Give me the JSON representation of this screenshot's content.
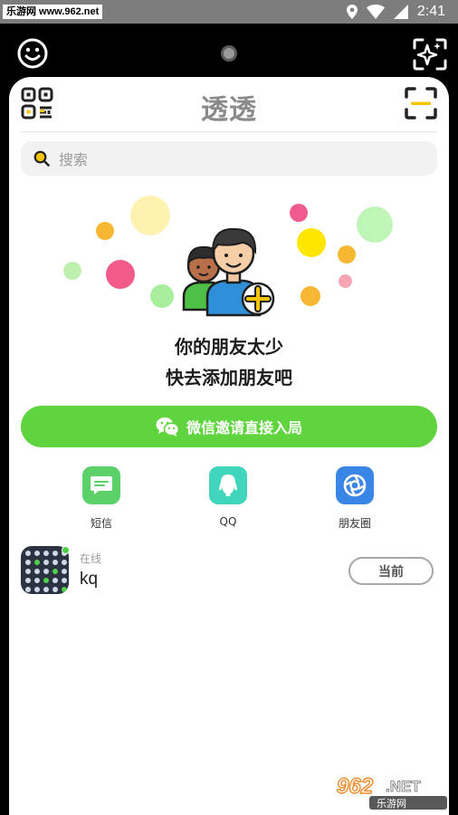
{
  "status_bar": {
    "watermark": "乐游网 www.962.net",
    "time": "2:41"
  },
  "header": {
    "title": "透透"
  },
  "search": {
    "placeholder": "搜索"
  },
  "empty_state": {
    "line1": "你的朋友太少",
    "line2": "快去添加朋友吧"
  },
  "invite_button": {
    "label": "微信邀请直接入局"
  },
  "share_options": [
    {
      "label": "短信",
      "icon": "message-icon",
      "color": "#5cd16a"
    },
    {
      "label": "QQ",
      "icon": "qq-icon",
      "color": "#3fd6bb"
    },
    {
      "label": "朋友圈",
      "icon": "moments-icon",
      "color": "#3a86e6"
    }
  ],
  "account": {
    "status": "在线",
    "name": "kq",
    "action_label": "当前"
  },
  "watermark_brand": "962.NET 乐游网",
  "colors": {
    "accent_green": "#5fd43f",
    "title_gray": "#8a8a8a",
    "qr_yellow": "#f5c400"
  }
}
